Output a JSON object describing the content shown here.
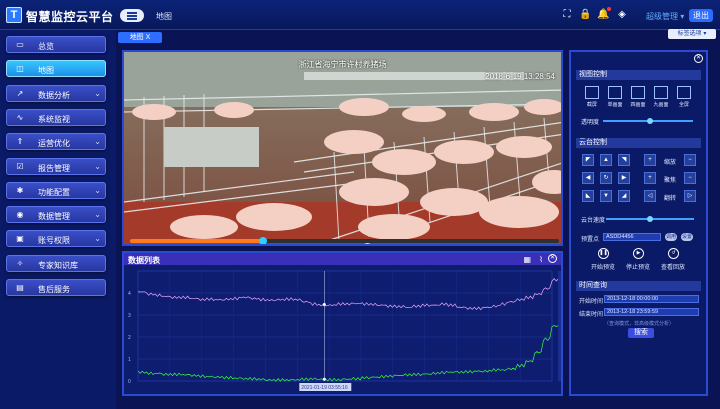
{
  "app": {
    "title": "智慧监控云平台",
    "logo": "T",
    "crumb": "地图",
    "user": "超级管理",
    "logout": "退出"
  },
  "icons": [
    "fullscreen-icon",
    "lock-icon",
    "bell-icon",
    "paint-bucket-icon"
  ],
  "nav": [
    {
      "label": "总览",
      "icon": "monitor-icon",
      "chevron": false
    },
    {
      "label": "地图",
      "icon": "map-icon",
      "chevron": false,
      "active": true
    },
    {
      "label": "数据分析",
      "icon": "chart-icon",
      "chevron": true
    },
    {
      "label": "系统监视",
      "icon": "pulse-icon",
      "chevron": false
    },
    {
      "label": "运营优化",
      "icon": "rocket-icon",
      "chevron": true
    },
    {
      "label": "报告管理",
      "icon": "report-icon",
      "chevron": true
    },
    {
      "label": "功能配置",
      "icon": "gear-icon",
      "chevron": true
    },
    {
      "label": "数据管理",
      "icon": "database-icon",
      "chevron": true
    },
    {
      "label": "账号权限",
      "icon": "lock-icon",
      "chevron": true
    },
    {
      "label": "专家知识库",
      "icon": "bulb-icon",
      "chevron": false
    },
    {
      "label": "售后服务",
      "icon": "service-icon",
      "chevron": false
    }
  ],
  "tab": "地图 X",
  "tag_option": "标签选项 ▾",
  "video": {
    "title": "浙江省海宁市许村养猪场",
    "timestamp": "2018-6-19 13:28:54",
    "progress": 0.31
  },
  "datalist": {
    "title": "数据列表",
    "tooltip": "2021-01-19 03:55:16"
  },
  "chart_data": {
    "type": "line",
    "ylim": [
      0,
      5
    ],
    "yticks": [
      "0",
      "1",
      "2",
      "3",
      "4"
    ],
    "series": [
      {
        "color": "#e8a8ff",
        "values": [
          4.05,
          3.95,
          3.9,
          3.85,
          3.8,
          3.8,
          3.75,
          3.7,
          3.72,
          3.7,
          3.72,
          3.75,
          3.8,
          3.75,
          3.7,
          3.68,
          3.7,
          3.72,
          3.7,
          3.6,
          3.5,
          3.45,
          3.45,
          3.5,
          3.5,
          3.52,
          3.5,
          3.48,
          3.45,
          3.4,
          3.38,
          3.35,
          3.4,
          3.45,
          3.45,
          3.5,
          3.45,
          3.35,
          3.3,
          3.3,
          3.35,
          3.4,
          3.5,
          3.6,
          3.7,
          3.8,
          3.95,
          4.2,
          4.6
        ]
      },
      {
        "color": "#3aff3a",
        "values": [
          0.4,
          0.35,
          0.35,
          0.3,
          0.3,
          0.28,
          0.25,
          0.22,
          0.2,
          0.18,
          0.15,
          0.12,
          0.1,
          0.1,
          0.08,
          0.05,
          0.05,
          0.04,
          0.05,
          0.08,
          0.1,
          0.08,
          0.06,
          0.05,
          0.08,
          0.1,
          0.15,
          0.18,
          0.2,
          0.22,
          0.25,
          0.28,
          0.3,
          0.32,
          0.35,
          0.38,
          0.4,
          0.4,
          0.42,
          0.45,
          0.45,
          0.5,
          0.5,
          0.55,
          0.7,
          0.9,
          1.3,
          1.9,
          2.5
        ]
      }
    ]
  },
  "right": {
    "view_ctrl": "视图控制",
    "views": [
      "截屏",
      "单画面",
      "四画面",
      "九画面",
      "全屏"
    ],
    "transparency": "透明度",
    "ptz_ctrl": "云台控制",
    "zoom": "缩放",
    "focus": "聚焦",
    "flip": "翻转",
    "ptz_speed": "云台速度",
    "preset_label": "预置点",
    "preset_value": "ASDD4456",
    "pill1": "调用",
    "pill2": "设置",
    "play": "开始预览",
    "stop": "停止预览",
    "replay": "查看回放",
    "time_query": "时间查询",
    "start_label": "开始时间：",
    "start_value": "2013-12-18 00:00:00",
    "end_label": "结束时间：",
    "end_value": "2013-12-18 23:59:59",
    "hint": "（查询模式，非高级模式分析）",
    "query": "搜索"
  }
}
